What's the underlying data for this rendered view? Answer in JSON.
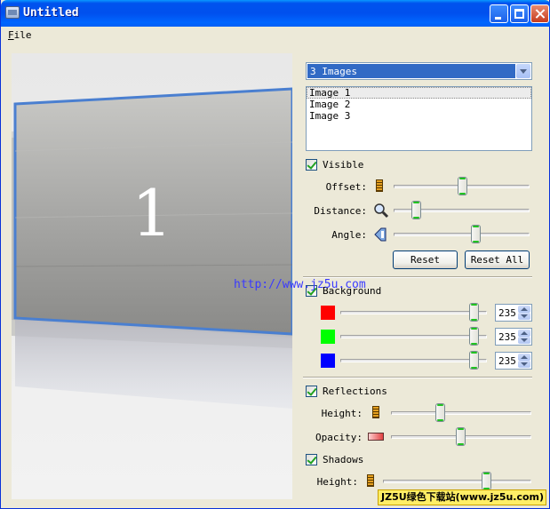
{
  "window": {
    "title": "Untitled"
  },
  "menu": {
    "file": "File"
  },
  "preview": {
    "current_label": "1"
  },
  "images": {
    "combo_value": "3 Images",
    "list": [
      "Image 1",
      "Image 2",
      "Image 3"
    ],
    "selected_index": 0
  },
  "image_props": {
    "visible_label": "Visible",
    "visible_checked": true,
    "offset_label": "Offset:",
    "distance_label": "Distance:",
    "angle_label": "Angle:",
    "offset_value": 0.5,
    "distance_value": 0.1,
    "angle_value": 0.61,
    "reset_label": "Reset",
    "reset_all_label": "Reset All"
  },
  "background": {
    "label": "Background",
    "checked": true,
    "red": 235,
    "green": 235,
    "blue": 235,
    "swatch_colors": [
      "#ff0000",
      "#00ff00",
      "#0000ff"
    ]
  },
  "reflections": {
    "label": "Reflections",
    "checked": true,
    "height_label": "Height:",
    "opacity_label": "Opacity:",
    "height_value": 0.35,
    "opacity_value": 0.5
  },
  "shadows": {
    "label": "Shadows",
    "checked": true,
    "height_label": "Height:",
    "height_value": 0.7
  },
  "watermark": "http://www.jz5u.com",
  "footer_badge": "JZ5U绿色下载站(www.jz5u.com)",
  "accent_colors": {
    "title_bar": "#0053ee",
    "selection": "#316ac5",
    "panel_border": "#4a7fd0"
  }
}
